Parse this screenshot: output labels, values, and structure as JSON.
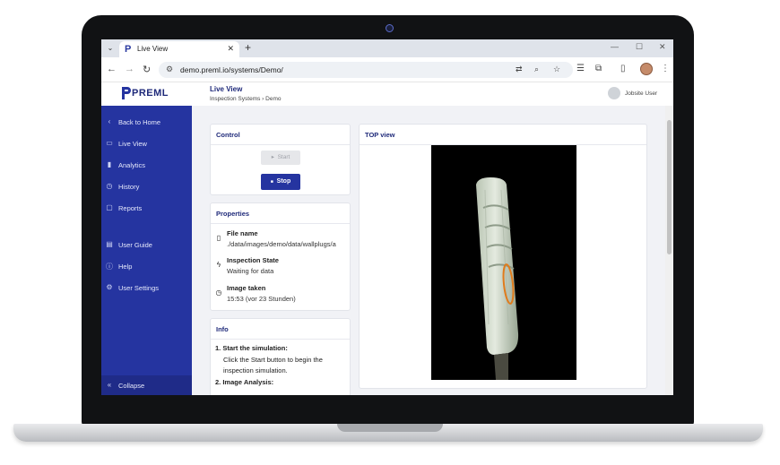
{
  "browser": {
    "tab_title": "Live View",
    "url": "demo.preml.io/systems/Demo/"
  },
  "app": {
    "logo": "PREML",
    "page_title": "Live View",
    "breadcrumb": "Inspection Systems  ›  Demo",
    "user_name": "Jobsite User"
  },
  "sidebar": {
    "items": [
      {
        "label": "Back to Home",
        "icon": "chevron-left-icon"
      },
      {
        "label": "Live View",
        "icon": "camera-icon"
      },
      {
        "label": "Analytics",
        "icon": "bar-chart-icon"
      },
      {
        "label": "History",
        "icon": "history-icon"
      },
      {
        "label": "Reports",
        "icon": "reports-icon"
      },
      {
        "label": "User Guide",
        "icon": "book-icon"
      },
      {
        "label": "Help",
        "icon": "help-icon"
      },
      {
        "label": "User Settings",
        "icon": "gear-icon"
      }
    ],
    "collapse_label": "Collapse"
  },
  "control": {
    "title": "Control",
    "start_label": "Start",
    "stop_label": "Stop"
  },
  "properties": {
    "title": "Properties",
    "file_name_label": "File name",
    "file_name_value": "./data/images/demo/data/wallplugs/a",
    "state_label": "Inspection State",
    "state_value": "Waiting for data",
    "taken_label": "Image taken",
    "taken_value": "15:53 (vor 23 Stunden)"
  },
  "info": {
    "title": "Info",
    "step1_title": "1. Start the simulation:",
    "step1_line1": "Click the Start button to begin the",
    "step1_line2": "inspection simulation.",
    "step2_title": "2. Image Analysis:"
  },
  "view": {
    "title": "TOP view"
  },
  "colors": {
    "primary": "#2534a0",
    "highlight": "#e07b1c"
  }
}
